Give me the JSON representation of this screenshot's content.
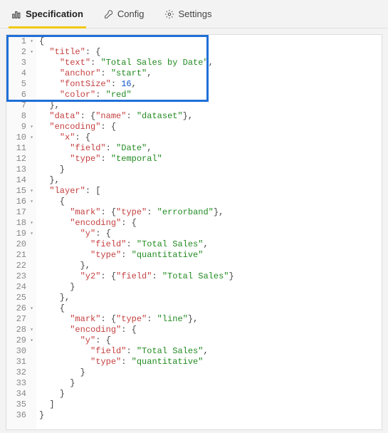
{
  "tabs": {
    "specification": "Specification",
    "config": "Config",
    "settings": "Settings"
  },
  "gutter": [
    {
      "n": "1",
      "f": "▾"
    },
    {
      "n": "2",
      "f": "▾"
    },
    {
      "n": "3",
      "f": ""
    },
    {
      "n": "4",
      "f": ""
    },
    {
      "n": "5",
      "f": ""
    },
    {
      "n": "6",
      "f": ""
    },
    {
      "n": "7",
      "f": ""
    },
    {
      "n": "8",
      "f": ""
    },
    {
      "n": "9",
      "f": "▾"
    },
    {
      "n": "10",
      "f": "▾"
    },
    {
      "n": "11",
      "f": ""
    },
    {
      "n": "12",
      "f": ""
    },
    {
      "n": "13",
      "f": ""
    },
    {
      "n": "14",
      "f": ""
    },
    {
      "n": "15",
      "f": "▾"
    },
    {
      "n": "16",
      "f": "▾"
    },
    {
      "n": "17",
      "f": ""
    },
    {
      "n": "18",
      "f": "▾"
    },
    {
      "n": "19",
      "f": "▾"
    },
    {
      "n": "20",
      "f": ""
    },
    {
      "n": "21",
      "f": ""
    },
    {
      "n": "22",
      "f": ""
    },
    {
      "n": "23",
      "f": ""
    },
    {
      "n": "24",
      "f": ""
    },
    {
      "n": "25",
      "f": ""
    },
    {
      "n": "26",
      "f": "▾"
    },
    {
      "n": "27",
      "f": ""
    },
    {
      "n": "28",
      "f": "▾"
    },
    {
      "n": "29",
      "f": "▾"
    },
    {
      "n": "30",
      "f": ""
    },
    {
      "n": "31",
      "f": ""
    },
    {
      "n": "32",
      "f": ""
    },
    {
      "n": "33",
      "f": ""
    },
    {
      "n": "34",
      "f": ""
    },
    {
      "n": "35",
      "f": ""
    },
    {
      "n": "36",
      "f": ""
    }
  ],
  "code_tokens": [
    [
      [
        "p",
        "{"
      ]
    ],
    [
      [
        "p",
        "  "
      ],
      [
        "k",
        "\"title\""
      ],
      [
        "p",
        ": {"
      ]
    ],
    [
      [
        "p",
        "    "
      ],
      [
        "k",
        "\"text\""
      ],
      [
        "p",
        ": "
      ],
      [
        "s",
        "\"Total Sales by Date\""
      ],
      [
        "p",
        ","
      ]
    ],
    [
      [
        "p",
        "    "
      ],
      [
        "k",
        "\"anchor\""
      ],
      [
        "p",
        ": "
      ],
      [
        "s",
        "\"start\""
      ],
      [
        "p",
        ","
      ]
    ],
    [
      [
        "p",
        "    "
      ],
      [
        "k",
        "\"fontSize\""
      ],
      [
        "p",
        ": "
      ],
      [
        "n",
        "16"
      ],
      [
        "p",
        ","
      ]
    ],
    [
      [
        "p",
        "    "
      ],
      [
        "k",
        "\"color\""
      ],
      [
        "p",
        ": "
      ],
      [
        "s",
        "\"red\""
      ]
    ],
    [
      [
        "p",
        "  },"
      ]
    ],
    [
      [
        "p",
        "  "
      ],
      [
        "k",
        "\"data\""
      ],
      [
        "p",
        ": {"
      ],
      [
        "k",
        "\"name\""
      ],
      [
        "p",
        ": "
      ],
      [
        "s",
        "\"dataset\""
      ],
      [
        "p",
        "},"
      ]
    ],
    [
      [
        "p",
        "  "
      ],
      [
        "k",
        "\"encoding\""
      ],
      [
        "p",
        ": {"
      ]
    ],
    [
      [
        "p",
        "    "
      ],
      [
        "k",
        "\"x\""
      ],
      [
        "p",
        ": {"
      ]
    ],
    [
      [
        "p",
        "      "
      ],
      [
        "k",
        "\"field\""
      ],
      [
        "p",
        ": "
      ],
      [
        "s",
        "\"Date\""
      ],
      [
        "p",
        ","
      ]
    ],
    [
      [
        "p",
        "      "
      ],
      [
        "k",
        "\"type\""
      ],
      [
        "p",
        ": "
      ],
      [
        "s",
        "\"temporal\""
      ]
    ],
    [
      [
        "p",
        "    }"
      ]
    ],
    [
      [
        "p",
        "  },"
      ]
    ],
    [
      [
        "p",
        "  "
      ],
      [
        "k",
        "\"layer\""
      ],
      [
        "p",
        ": ["
      ]
    ],
    [
      [
        "p",
        "    {"
      ]
    ],
    [
      [
        "p",
        "      "
      ],
      [
        "k",
        "\"mark\""
      ],
      [
        "p",
        ": {"
      ],
      [
        "k",
        "\"type\""
      ],
      [
        "p",
        ": "
      ],
      [
        "s",
        "\"errorband\""
      ],
      [
        "p",
        "},"
      ]
    ],
    [
      [
        "p",
        "      "
      ],
      [
        "k",
        "\"encoding\""
      ],
      [
        "p",
        ": {"
      ]
    ],
    [
      [
        "p",
        "        "
      ],
      [
        "k",
        "\"y\""
      ],
      [
        "p",
        ": {"
      ]
    ],
    [
      [
        "p",
        "          "
      ],
      [
        "k",
        "\"field\""
      ],
      [
        "p",
        ": "
      ],
      [
        "s",
        "\"Total Sales\""
      ],
      [
        "p",
        ","
      ]
    ],
    [
      [
        "p",
        "          "
      ],
      [
        "k",
        "\"type\""
      ],
      [
        "p",
        ": "
      ],
      [
        "s",
        "\"quantitative\""
      ]
    ],
    [
      [
        "p",
        "        },"
      ]
    ],
    [
      [
        "p",
        "        "
      ],
      [
        "k",
        "\"y2\""
      ],
      [
        "p",
        ": {"
      ],
      [
        "k",
        "\"field\""
      ],
      [
        "p",
        ": "
      ],
      [
        "s",
        "\"Total Sales\""
      ],
      [
        "p",
        "}"
      ]
    ],
    [
      [
        "p",
        "      }"
      ]
    ],
    [
      [
        "p",
        "    },"
      ]
    ],
    [
      [
        "p",
        "    {"
      ]
    ],
    [
      [
        "p",
        "      "
      ],
      [
        "k",
        "\"mark\""
      ],
      [
        "p",
        ": {"
      ],
      [
        "k",
        "\"type\""
      ],
      [
        "p",
        ": "
      ],
      [
        "s",
        "\"line\""
      ],
      [
        "p",
        "},"
      ]
    ],
    [
      [
        "p",
        "      "
      ],
      [
        "k",
        "\"encoding\""
      ],
      [
        "p",
        ": {"
      ]
    ],
    [
      [
        "p",
        "        "
      ],
      [
        "k",
        "\"y\""
      ],
      [
        "p",
        ": {"
      ]
    ],
    [
      [
        "p",
        "          "
      ],
      [
        "k",
        "\"field\""
      ],
      [
        "p",
        ": "
      ],
      [
        "s",
        "\"Total Sales\""
      ],
      [
        "p",
        ","
      ]
    ],
    [
      [
        "p",
        "          "
      ],
      [
        "k",
        "\"type\""
      ],
      [
        "p",
        ": "
      ],
      [
        "s",
        "\"quantitative\""
      ]
    ],
    [
      [
        "p",
        "        }"
      ]
    ],
    [
      [
        "p",
        "      }"
      ]
    ],
    [
      [
        "p",
        "    }"
      ]
    ],
    [
      [
        "p",
        "  ]"
      ]
    ],
    [
      [
        "p",
        "}"
      ]
    ]
  ]
}
